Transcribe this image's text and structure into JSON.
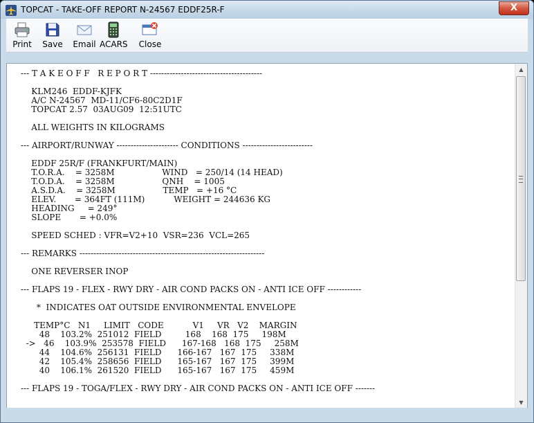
{
  "window": {
    "title": "TOPCAT - TAKE-OFF REPORT N-24567 EDDF25R-F",
    "close_symbol": "X"
  },
  "toolbar": [
    {
      "name": "print",
      "label": "Print",
      "icon": "printer-icon"
    },
    {
      "name": "save",
      "label": "Save",
      "icon": "floppy-disk-icon"
    },
    {
      "name": "email",
      "label": "Email",
      "icon": "envelope-icon"
    },
    {
      "name": "acars",
      "label": "ACARS",
      "icon": "keypad-device-icon"
    },
    {
      "name": "close",
      "label": "Close",
      "icon": "close-window-icon"
    }
  ],
  "report": {
    "lines": [
      "--- T A K E O F F   R E P O R T ----------------------------------------",
      "",
      "    KLM246  EDDF-KJFK",
      "    A/C N-24567  MD-11/CF6-80C2D1F",
      "    TOPCAT 2.57  03AUG09  12:51UTC",
      "",
      "    ALL WEIGHTS IN KILOGRAMS",
      "",
      "--- AIRPORT/RUNWAY ---------------------- CONDITIONS -------------------------",
      "",
      "    EDDF 25R/F (FRANKFURT/MAIN)",
      "    T.O.R.A.    = 3258M                  WIND   = 250/14 (14 HEAD)",
      "    T.O.D.A.    = 3258M                  QNH    = 1005",
      "    A.S.D.A.    = 3258M                  TEMP   = +16 °C",
      "    ELEV.       = 364FT (111M)           WEIGHT = 244636 KG",
      "    HEADING     = 249°",
      "    SLOPE       = +0.0%",
      "",
      "    SPEED SCHED : VFR=V2+10  VSR=236  VCL=265",
      "",
      "--- REMARKS ------------------------------------------------------------------",
      "",
      "    ONE REVERSER INOP",
      "",
      "--- FLAPS 19 - FLEX - RWY DRY - AIR COND PACKS ON - ANTI ICE OFF ------------",
      "",
      "      *  INDICATES OAT OUTSIDE ENVIRONMENTAL ENVELOPE",
      "",
      "     TEMP°C   N1     LIMIT   CODE           V1     VR   V2    MARGIN",
      "       48    103.2%  251012  FIELD         168    168  175     198M",
      "  ->   46    103.9%  253578  FIELD      167-168   168  175     258M",
      "       44    104.6%  256131  FIELD      166-167   167  175     338M",
      "       42    105.4%  258656  FIELD      165-167   167  175     399M",
      "       40    106.1%  261520  FIELD      165-167   167  175     459M",
      "",
      "--- FLAPS 19 - TOGA/FLEX - RWY DRY - AIR COND PACKS ON - ANTI ICE OFF -------"
    ]
  },
  "colors": {
    "title_bar": "#c6d9e8",
    "close_button": "#c0301d",
    "content_bg": "#ffffff"
  }
}
